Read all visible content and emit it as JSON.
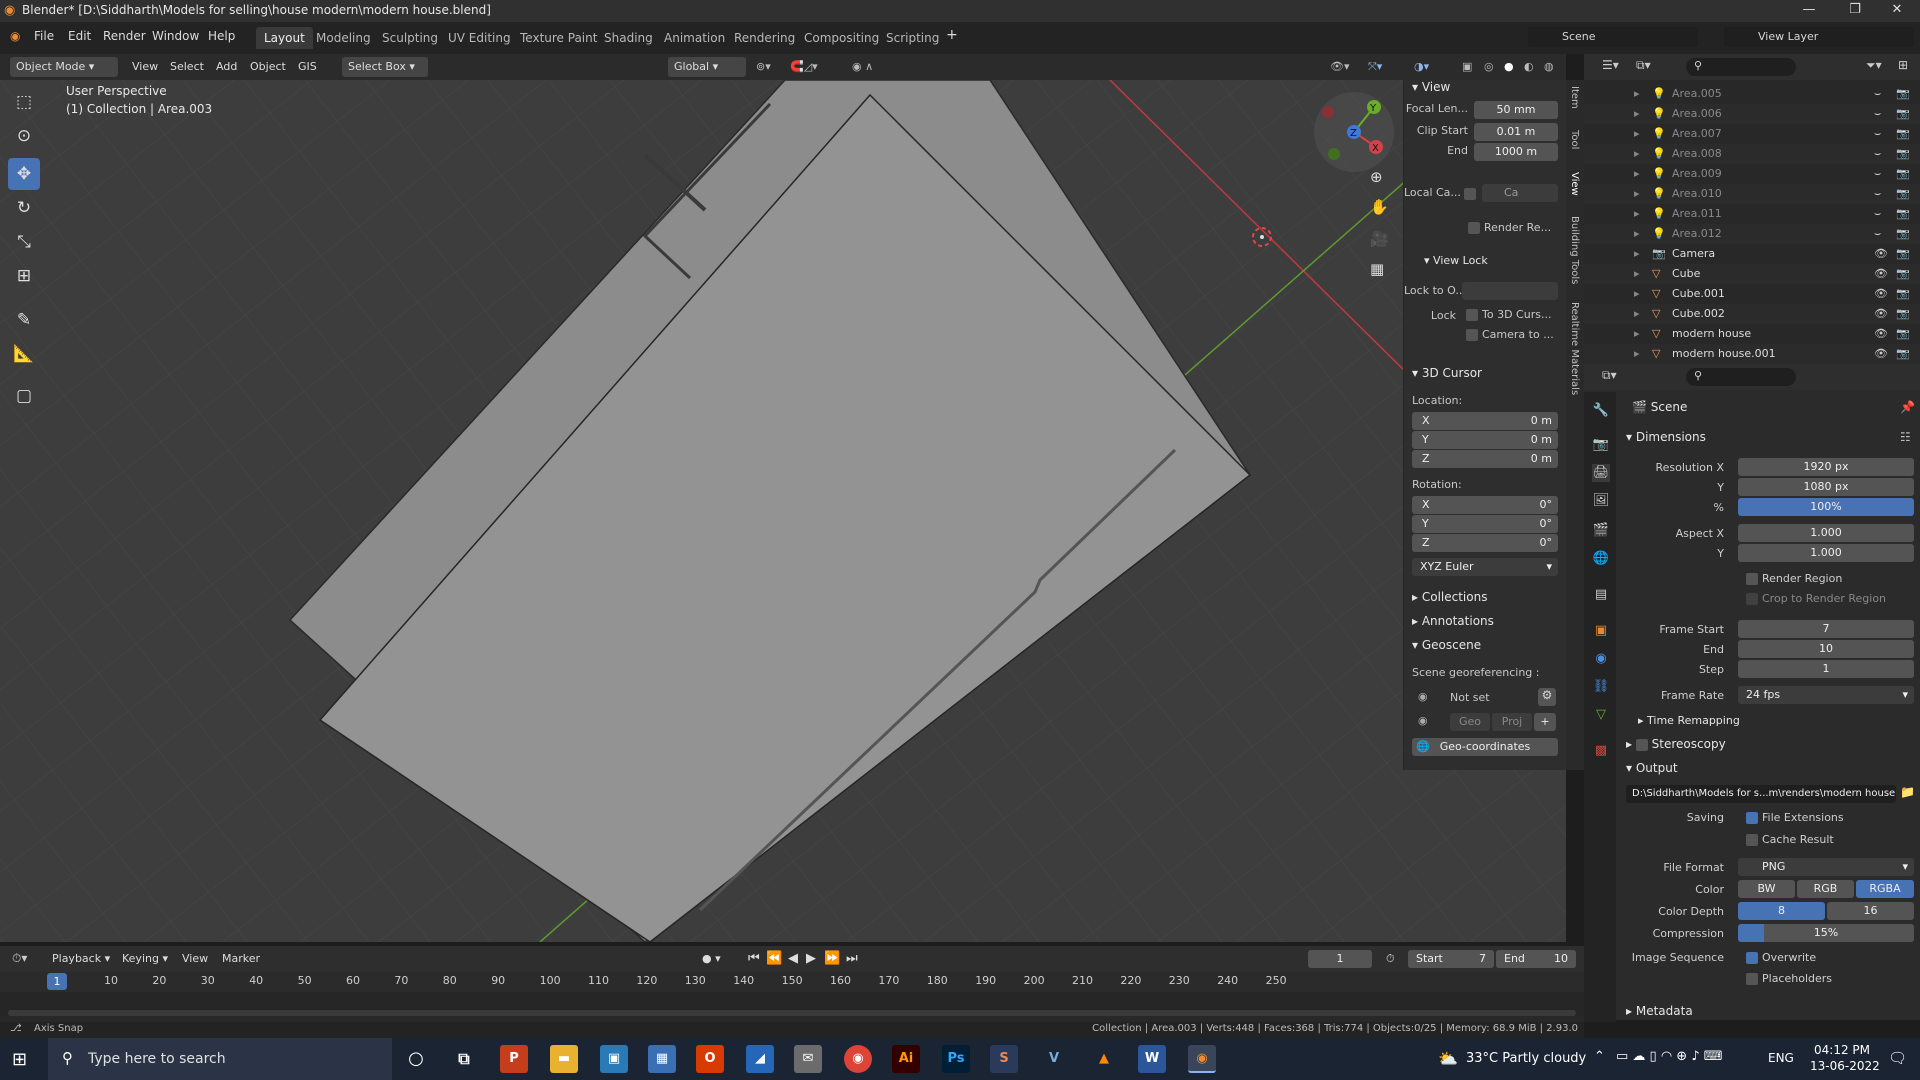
{
  "window": {
    "title": "Blender* [D:\\Siddharth\\Models for selling\\house modern\\modern house.blend]",
    "min": "—",
    "max": "❐",
    "close": "✕"
  },
  "menu": [
    "File",
    "Edit",
    "Render",
    "Window",
    "Help"
  ],
  "workspaces": [
    "Layout",
    "Modeling",
    "Sculpting",
    "UV Editing",
    "Texture Paint",
    "Shading",
    "Animation",
    "Rendering",
    "Compositing",
    "Scripting"
  ],
  "scene": {
    "label": "Scene",
    "view_layer": "View Layer"
  },
  "vp_header": {
    "mode": "Object Mode",
    "view": "View",
    "select": "Select",
    "add": "Add",
    "object": "Object",
    "gis": "GIS",
    "select_box": "Select Box",
    "transform": "Global"
  },
  "viewport": {
    "persp": "User Perspective",
    "collection": "(1) Collection | Area.003"
  },
  "npanel": {
    "view_title": "View",
    "focal_label": "Focal Len...",
    "focal": "50 mm",
    "clip_start_label": "Clip Start",
    "clip_start": "0.01 m",
    "end_label": "End",
    "clip_end": "1000 m",
    "local_cam_label": "Local Ca...",
    "local_cam_val": "Ca",
    "render_region": "Render Re...",
    "view_lock": "View Lock",
    "lock_obj_label": "Lock to O...",
    "lock_label": "Lock",
    "to_3d_cursor": "To 3D Curs...",
    "camera_to": "Camera to ...",
    "cursor_title": "3D Cursor",
    "location": "Location:",
    "rotation": "Rotation:",
    "x": "X",
    "y": "Y",
    "z": "Z",
    "loc_x": "0 m",
    "loc_y": "0 m",
    "loc_z": "0 m",
    "rot_x": "0°",
    "rot_y": "0°",
    "rot_z": "0°",
    "rot_mode": "XYZ Euler",
    "collections": "Collections",
    "annotations": "Annotations",
    "geoscene": "Geoscene",
    "georef": "Scene georeferencing :",
    "not_set": "Not set",
    "geo": "Geo",
    "proj": "Proj",
    "geo_coords": "Geo-coordinates"
  },
  "ntabs": [
    "Item",
    "Tool",
    "View",
    "Building Tools",
    "Realtime Materials"
  ],
  "outliner": [
    {
      "name": "Area.005",
      "dim": true
    },
    {
      "name": "Area.006",
      "dim": true
    },
    {
      "name": "Area.007",
      "dim": true
    },
    {
      "name": "Area.008",
      "dim": true
    },
    {
      "name": "Area.009",
      "dim": true
    },
    {
      "name": "Area.010",
      "dim": true
    },
    {
      "name": "Area.011",
      "dim": true
    },
    {
      "name": "Area.012",
      "dim": true
    },
    {
      "name": "Camera",
      "dim": false
    },
    {
      "name": "Cube",
      "dim": false
    },
    {
      "name": "Cube.001",
      "dim": false
    },
    {
      "name": "Cube.002",
      "dim": false
    },
    {
      "name": "modern house",
      "dim": false
    },
    {
      "name": "modern house.001",
      "dim": false
    }
  ],
  "props": {
    "scene": "Scene",
    "dimensions": "Dimensions",
    "res_x_label": "Resolution X",
    "res_x": "1920 px",
    "y_label": "Y",
    "res_y": "1080 px",
    "pct_label": "%",
    "pct": "100%",
    "aspect_x_label": "Aspect X",
    "aspect_x": "1.000",
    "aspect_y": "1.000",
    "render_region": "Render Region",
    "crop": "Crop to Render Region",
    "frame_start_label": "Frame Start",
    "frame_start": "7",
    "end_label": "End",
    "frame_end": "10",
    "step_label": "Step",
    "step": "1",
    "frame_rate_label": "Frame Rate",
    "frame_rate": "24 fps",
    "time_remap": "Time Remapping",
    "stereo": "Stereoscopy",
    "output": "Output",
    "path": "D:\\Siddharth\\Models for s...m\\renders\\modern house",
    "saving": "Saving",
    "file_ext": "File Extensions",
    "cache": "Cache Result",
    "file_format_label": "File Format",
    "file_format": "PNG",
    "color_label": "Color",
    "bw": "BW",
    "rgb": "RGB",
    "rgba": "RGBA",
    "depth_label": "Color Depth",
    "d8": "8",
    "d16": "16",
    "comp_label": "Compression",
    "comp": "15%",
    "comp_frac": 0.15,
    "imgseq_label": "Image Sequence",
    "overwrite": "Overwrite",
    "placeholders": "Placeholders",
    "metadata": "Metadata"
  },
  "timeline": {
    "playback": "Playback",
    "keying": "Keying",
    "view": "View",
    "marker": "Marker",
    "current": "1",
    "start_label": "Start",
    "start": "7",
    "end_label": "End",
    "end": "10",
    "ticks": [
      "1",
      "10",
      "20",
      "30",
      "40",
      "50",
      "60",
      "70",
      "80",
      "90",
      "100",
      "110",
      "120",
      "130",
      "140",
      "150",
      "160",
      "170",
      "180",
      "190",
      "200",
      "210",
      "220",
      "230",
      "240",
      "250"
    ]
  },
  "status": {
    "left": "Axis Snap",
    "right": "Collection | Area.003 | Verts:448 | Faces:368 | Tris:774 | Objects:0/25 | Memory: 68.9 MiB | 2.93.0"
  },
  "taskbar": {
    "search": "Type here to search",
    "weather": "33°C  Partly cloudy",
    "lang": "ENG",
    "time": "04:12 PM",
    "date": "13-06-2022"
  },
  "colors": {
    "accent": "#4772b3",
    "bg": "#3d3d3d"
  }
}
